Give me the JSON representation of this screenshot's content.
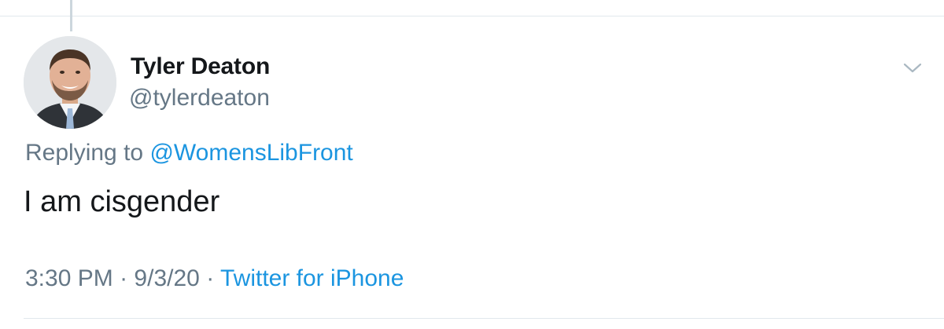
{
  "tweet": {
    "author": {
      "display_name": "Tyler Deaton",
      "handle": "@tylerdeaton"
    },
    "replying_prefix": "Replying to",
    "reply_target": "@WomensLibFront",
    "text": "I am cisgender",
    "time": "3:30 PM",
    "separator": "·",
    "date": "9/3/20",
    "source": "Twitter for iPhone",
    "menu_icon": "chevron-down-icon",
    "avatar_icon": "avatar-photo"
  },
  "colors": {
    "primary_text": "#14171a",
    "secondary_text": "#657786",
    "link": "#1b95e0",
    "divider": "#e1e8ed",
    "thread_line": "#ccd6dd"
  }
}
